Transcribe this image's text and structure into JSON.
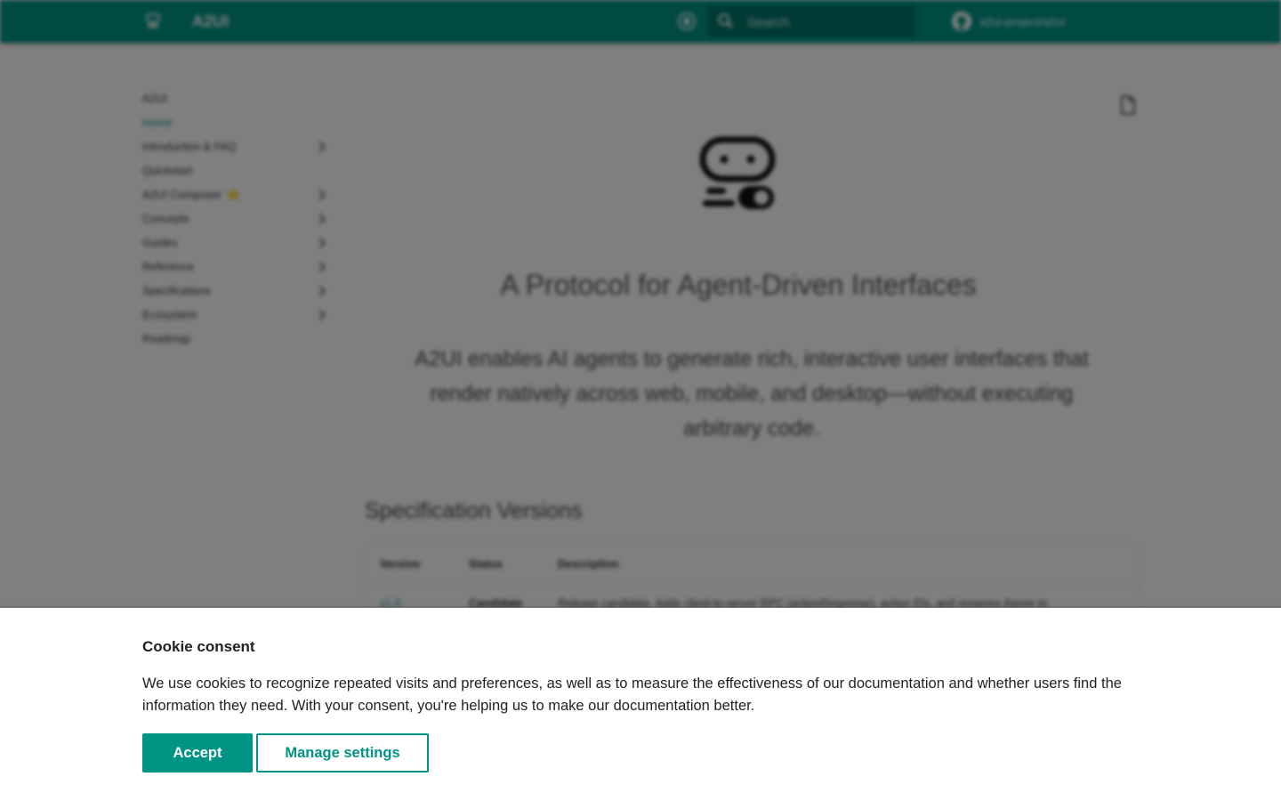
{
  "header": {
    "site_title": "A2UI",
    "search_placeholder": "Search",
    "repo_label": "a2ui-project/a2ui",
    "icons": [
      "robot-logo-icon",
      "palette-icon",
      "search-icon",
      "github-icon"
    ]
  },
  "sidebar": {
    "title": "A2UI",
    "items": [
      {
        "label": "Home",
        "active": true,
        "expandable": false
      },
      {
        "label": "Introduction & FAQ",
        "expandable": true
      },
      {
        "label": "Quickstart",
        "expandable": false
      },
      {
        "label": "A2UI Composer",
        "badge": "⭐",
        "expandable": true
      },
      {
        "label": "Concepts",
        "expandable": true
      },
      {
        "label": "Guides",
        "expandable": true
      },
      {
        "label": "Reference",
        "expandable": true
      },
      {
        "label": "Specifications",
        "expandable": true
      },
      {
        "label": "Ecosystem",
        "expandable": true
      },
      {
        "label": "Roadmap",
        "expandable": false
      }
    ]
  },
  "main": {
    "hero_title": "A Protocol for Agent-Driven Interfaces",
    "hero_subtitle": "A2UI enables AI agents to generate rich, interactive user interfaces that render natively across web, mobile, and desktop—without executing arbitrary code.",
    "spec_heading": "Specification Versions",
    "table": {
      "headers": [
        "Version",
        "Status",
        "Description"
      ],
      "rows": [
        [
          "v1.0",
          "Candidate",
          "Release candidate. Adds client-to-server RPC (actionResponse), action IDs, and renames theme to"
        ]
      ]
    }
  },
  "consent": {
    "title": "Cookie consent",
    "text": "We use cookies to recognize repeated visits and preferences, as well as to measure the effectiveness of our documentation and whether users find the information they need. With your consent, you're helping us to make our documentation better.",
    "accept_label": "Accept",
    "manage_label": "Manage settings"
  },
  "colors": {
    "brand": "#009485",
    "accent_star": "#f5c400"
  }
}
